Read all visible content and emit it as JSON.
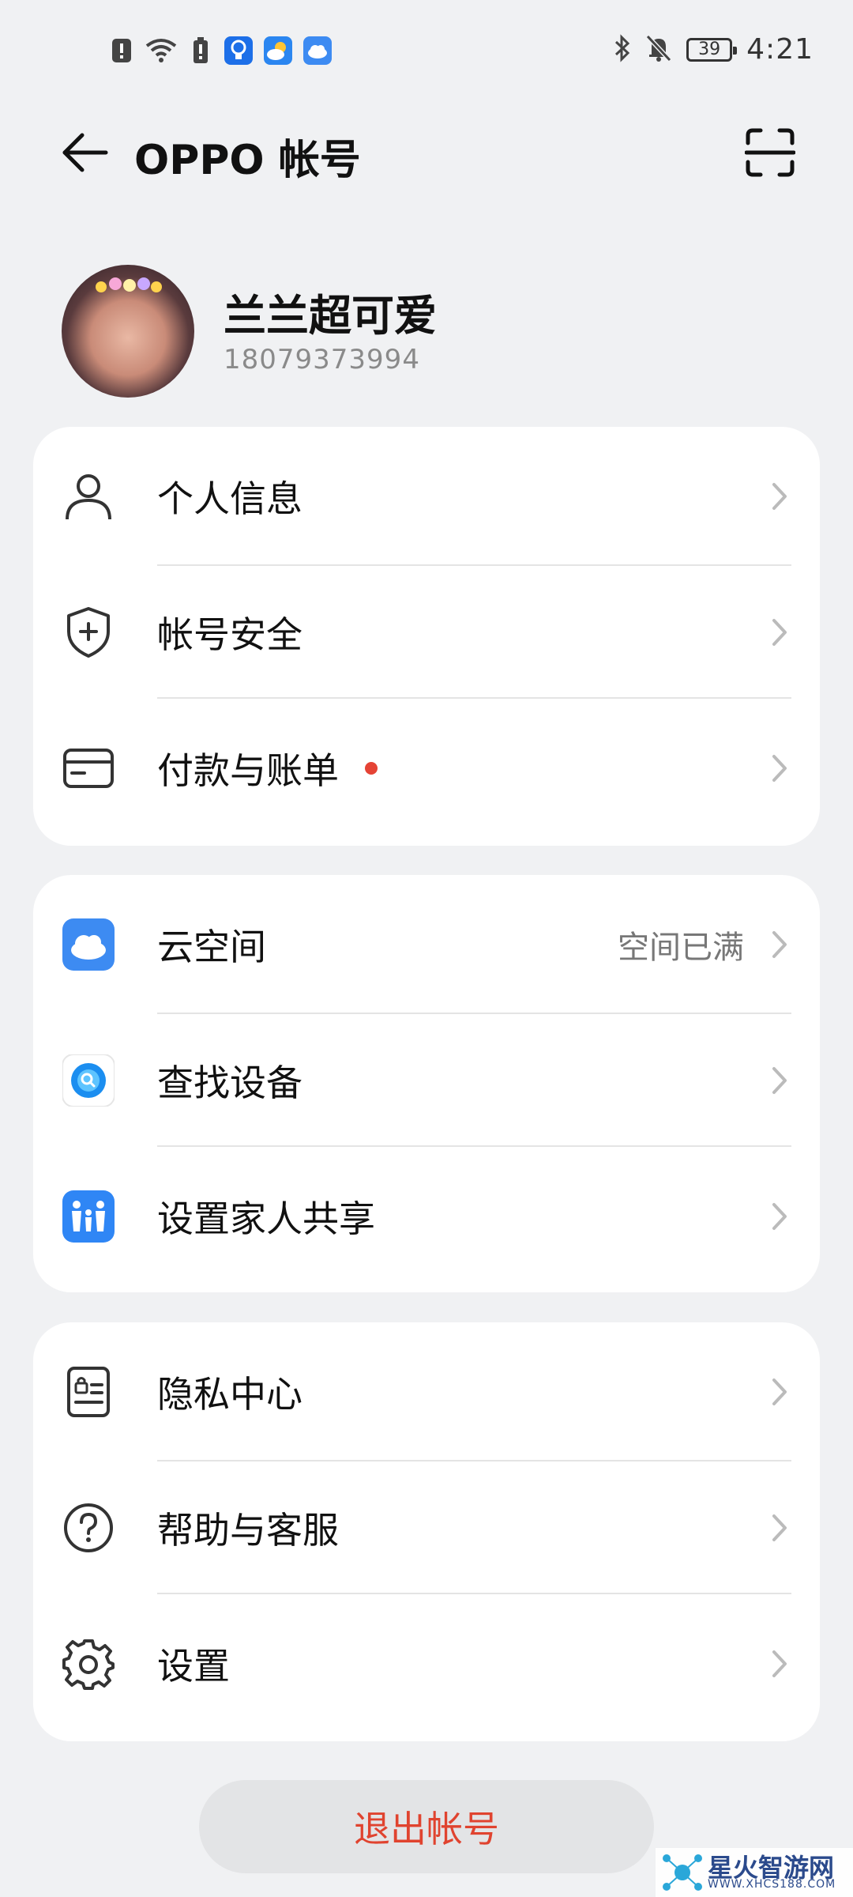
{
  "status_bar": {
    "battery": "39",
    "time": "4:21"
  },
  "header": {
    "title": "OPPO 帐号"
  },
  "profile": {
    "name": "兰兰超可爱",
    "phone": "18079373994"
  },
  "group1": [
    {
      "label": "个人信息",
      "icon": "person-icon"
    },
    {
      "label": "帐号安全",
      "icon": "shield-icon"
    },
    {
      "label": "付款与账单",
      "icon": "card-icon",
      "badge": "red-dot"
    }
  ],
  "group2": [
    {
      "label": "云空间",
      "value": "空间已满",
      "icon": "cloud-icon"
    },
    {
      "label": "查找设备",
      "icon": "find-device-icon"
    },
    {
      "label": "设置家人共享",
      "icon": "family-icon"
    }
  ],
  "group3": [
    {
      "label": "隐私中心",
      "icon": "privacy-icon"
    },
    {
      "label": "帮助与客服",
      "icon": "help-icon"
    },
    {
      "label": "设置",
      "icon": "gear-icon"
    }
  ],
  "logout_label": "退出帐号",
  "watermark": {
    "title": "星火智游网",
    "url": "WWW.XHCS188.COM"
  },
  "colors": {
    "accent_red": "#e0432f",
    "cloud_blue": "#3d8bf2",
    "background": "#f0f1f3"
  }
}
